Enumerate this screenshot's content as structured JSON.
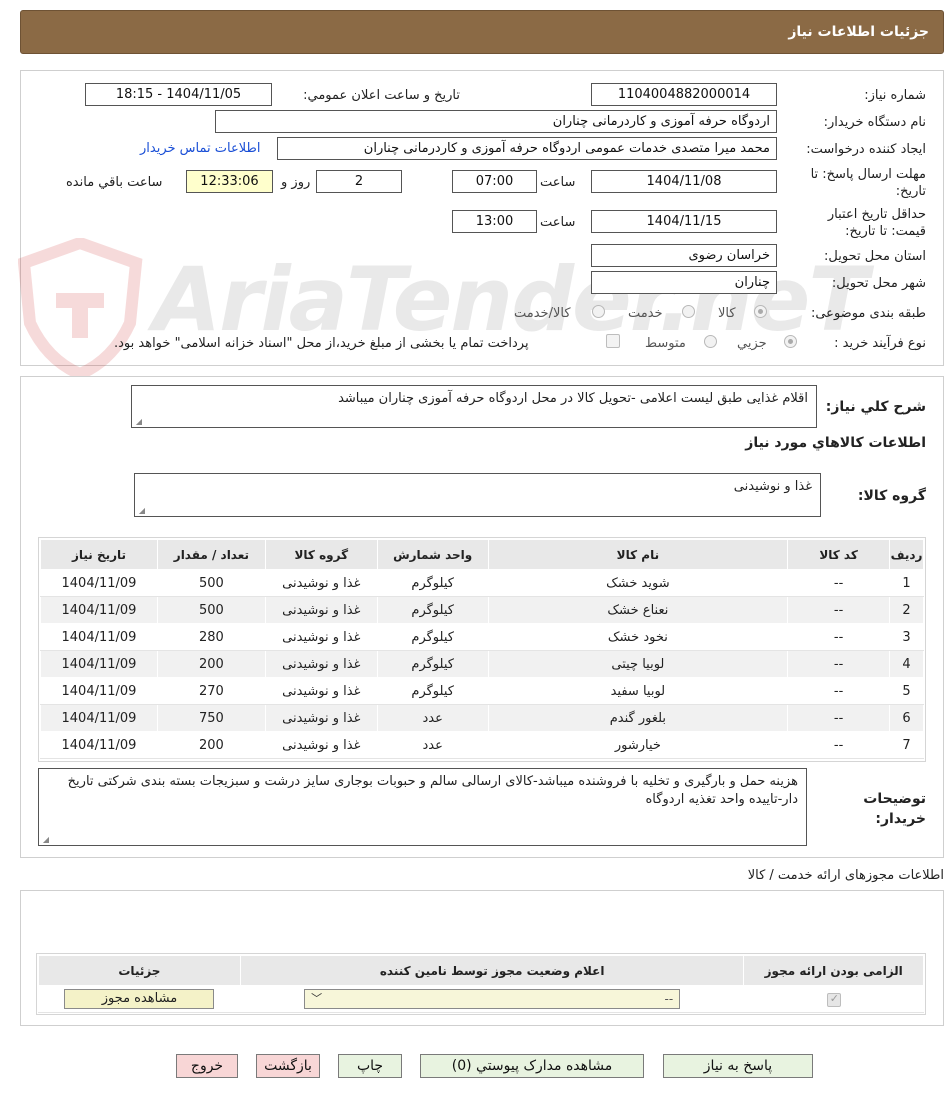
{
  "header": {
    "title": "جزئیات اطلاعات نیاز"
  },
  "watermark": {
    "text": "AriaTender.neT"
  },
  "form": {
    "need_number_label": "شماره نیاز:",
    "need_number": "1104004882000014",
    "announce_label": "تاریخ و ساعت اعلان عمومي:",
    "announce_value": "1404/11/05 - 18:15",
    "buyer_org_label": "نام دستگاه خریدار:",
    "buyer_org": "اردوگاه حرفه آموزی و کاردرمانی چناران",
    "creator_label": "ایجاد کننده درخواست:",
    "creator": "محمد میرا متصدی خدمات عمومی اردوگاه حرفه آموزی و کاردرمانی چناران",
    "contact_link": "اطلاعات تماس خریدار",
    "reply_deadline_label": "مهلت ارسال پاسخ: تا تاریخ:",
    "reply_date": "1404/11/08",
    "time_label": "ساعت",
    "reply_time": "07:00",
    "days_value": "2",
    "days_label": "روز و",
    "remaining_time": "12:33:06",
    "remaining_label": "ساعت باقي مانده",
    "validity_label": "حداقل تاریخ اعتبار قیمت: تا تاریخ:",
    "validity_date": "1404/11/15",
    "validity_time": "13:00",
    "province_label": "استان محل تحویل:",
    "province": "خراسان رضوی",
    "city_label": "شهر محل تحویل:",
    "city": "چناران",
    "category_label": "طبقه بندی موضوعی:",
    "category_options": [
      "کالا",
      "خدمت",
      "کالا/خدمت"
    ],
    "process_label": "نوع فرآیند خرید :",
    "process_options": [
      "جزیي",
      "متوسط"
    ],
    "payment_note": "پرداخت تمام یا بخشی از مبلغ خرید،از محل \"اسناد خزانه اسلامی\" خواهد بود."
  },
  "summary": {
    "label": "شرح کلي نیاز:",
    "text": "اقلام غذایی طبق لیست اعلامی -تحویل کالا در محل اردوگاه حرفه آموزی چناران میباشد",
    "goods_info_title": "اطلاعات کالاهاي مورد نیاز",
    "goods_group_label": "گروه کالا:",
    "goods_group": "غذا و نوشیدنی"
  },
  "table": {
    "headers": [
      "ردیف",
      "کد کالا",
      "نام کالا",
      "واحد شمارش",
      "گروه کالا",
      "تعداد / مقدار",
      "تاریخ نیاز"
    ],
    "rows": [
      [
        "1",
        "--",
        "شوید خشک",
        "کیلوگرم",
        "غذا و نوشیدنی",
        "500",
        "1404/11/09"
      ],
      [
        "2",
        "--",
        "نعناع خشک",
        "کیلوگرم",
        "غذا و نوشیدنی",
        "500",
        "1404/11/09"
      ],
      [
        "3",
        "--",
        "نخود خشک",
        "کیلوگرم",
        "غذا و نوشیدنی",
        "280",
        "1404/11/09"
      ],
      [
        "4",
        "--",
        "لوبیا چیتی",
        "کیلوگرم",
        "غذا و نوشیدنی",
        "200",
        "1404/11/09"
      ],
      [
        "5",
        "--",
        "لوبیا سفید",
        "کیلوگرم",
        "غذا و نوشیدنی",
        "270",
        "1404/11/09"
      ],
      [
        "6",
        "--",
        "بلغور گندم",
        "عدد",
        "غذا و نوشیدنی",
        "750",
        "1404/11/09"
      ],
      [
        "7",
        "--",
        "خیارشور",
        "عدد",
        "غذا و نوشیدنی",
        "200",
        "1404/11/09"
      ]
    ]
  },
  "buyer_notes": {
    "label": "توضیحات خریدار:",
    "text": "هزینه حمل و بارگیری و تخلیه با فروشنده میباشد-کالای ارسالی سالم و حبوبات بوجاری سایز درشت و سبزیجات بسته بندی شرکتی تاریخ دار-تاییده واحد تغذیه اردوگاه"
  },
  "licenses": {
    "title": "اطلاعات مجوزهای ارائه خدمت / کالا",
    "headers": [
      "الزامی بودن ارائه مجوز",
      "اعلام وضعیت مجوز توسط نامین کننده",
      "جزئیات"
    ],
    "select_value": "--",
    "view_button": "مشاهده مجوز"
  },
  "buttons": {
    "reply": "پاسخ به نیاز",
    "attachments": "مشاهده مدارک پیوستي (0)",
    "print": "چاپ",
    "back": "بازگشت",
    "exit": "خروج"
  }
}
